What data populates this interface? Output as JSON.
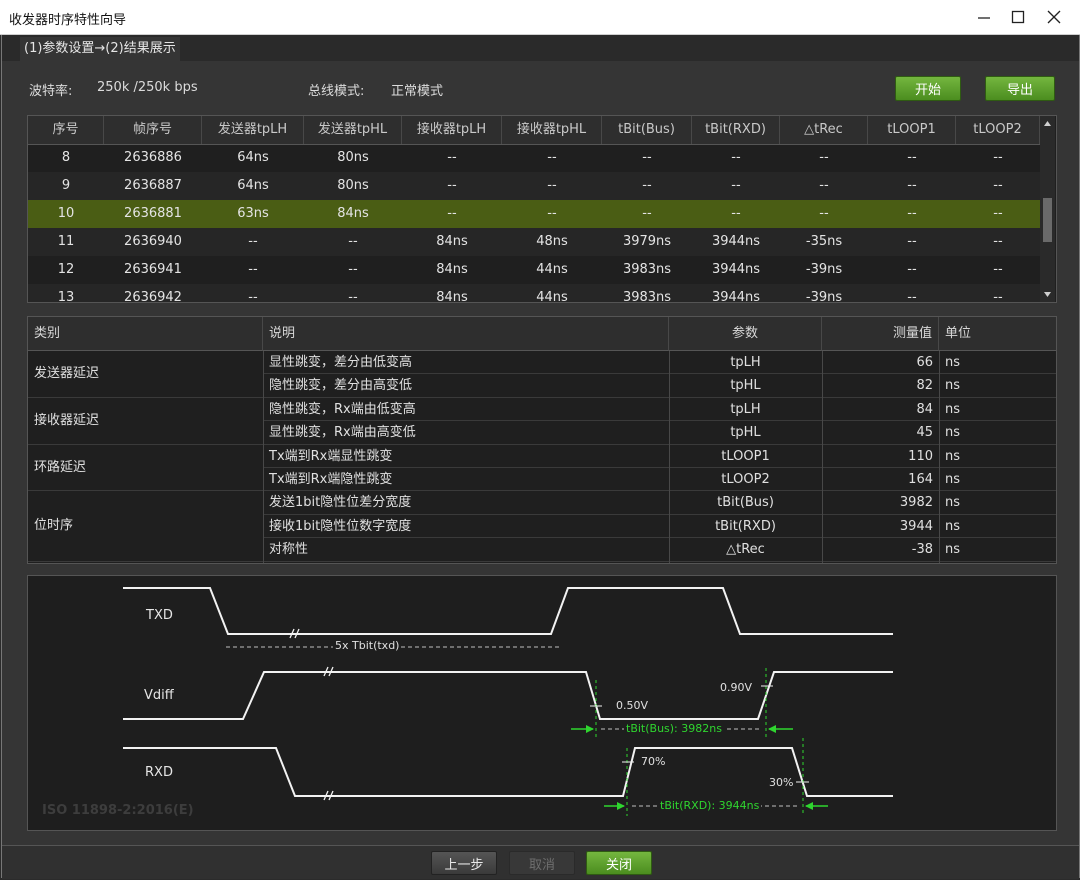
{
  "window": {
    "title": "收发器时序特性向导",
    "controls": [
      "minimize-icon",
      "maximize-icon",
      "close-icon"
    ]
  },
  "tabs": [
    {
      "label": "(1)参数设置→(2)结果展示"
    }
  ],
  "settings": {
    "baud_label": "波特率:",
    "baud_value": "250k /250k bps",
    "bus_mode_label": "总线模式:",
    "bus_mode_value": "正常模式"
  },
  "actions": {
    "start": "开始",
    "export": "导出"
  },
  "results_table": {
    "columns": [
      "序号",
      "帧序号",
      "发送器tpLH",
      "发送器tpHL",
      "接收器tpLH",
      "接收器tpHL",
      "tBit(Bus)",
      "tBit(RXD)",
      "△tRec",
      "tLOOP1",
      "tLOOP2"
    ],
    "rows": [
      [
        "8",
        "2636886",
        "64ns",
        "80ns",
        "--",
        "--",
        "--",
        "--",
        "--",
        "--",
        "--"
      ],
      [
        "9",
        "2636887",
        "64ns",
        "80ns",
        "--",
        "--",
        "--",
        "--",
        "--",
        "--",
        "--"
      ],
      [
        "10",
        "2636881",
        "63ns",
        "84ns",
        "--",
        "--",
        "--",
        "--",
        "--",
        "--",
        "--"
      ],
      [
        "11",
        "2636940",
        "--",
        "--",
        "84ns",
        "48ns",
        "3979ns",
        "3944ns",
        "-35ns",
        "--",
        "--"
      ],
      [
        "12",
        "2636941",
        "--",
        "--",
        "84ns",
        "44ns",
        "3983ns",
        "3944ns",
        "-39ns",
        "--",
        "--"
      ],
      [
        "13",
        "2636942",
        "--",
        "--",
        "84ns",
        "44ns",
        "3983ns",
        "3944ns",
        "-39ns",
        "--",
        "--"
      ]
    ],
    "selected_row_index": 2
  },
  "summary_table": {
    "headers": {
      "category": "类别",
      "desc": "说明",
      "param": "参数",
      "value": "测量值",
      "unit": "单位"
    },
    "groups": [
      {
        "category": "发送器延迟",
        "items": [
          {
            "desc": "显性跳变，差分由低变高",
            "param": "tpLH",
            "value": "66",
            "unit": "ns"
          },
          {
            "desc": "隐性跳变，差分由高变低",
            "param": "tpHL",
            "value": "82",
            "unit": "ns"
          }
        ]
      },
      {
        "category": "接收器延迟",
        "items": [
          {
            "desc": "隐性跳变，Rx端由低变高",
            "param": "tpLH",
            "value": "84",
            "unit": "ns"
          },
          {
            "desc": "显性跳变，Rx端由高变低",
            "param": "tpHL",
            "value": "45",
            "unit": "ns"
          }
        ]
      },
      {
        "category": "环路延迟",
        "items": [
          {
            "desc": "Tx端到Rx端显性跳变",
            "param": "tLOOP1",
            "value": "110",
            "unit": "ns"
          },
          {
            "desc": "Tx端到Rx端隐性跳变",
            "param": "tLOOP2",
            "value": "164",
            "unit": "ns"
          }
        ]
      },
      {
        "category": "位时序",
        "items": [
          {
            "desc": "发送1bit隐性位差分宽度",
            "param": "tBit(Bus)",
            "value": "3982",
            "unit": "ns"
          },
          {
            "desc": "接收1bit隐性位数字宽度",
            "param": "tBit(RXD)",
            "value": "3944",
            "unit": "ns"
          },
          {
            "desc": "对称性",
            "param": "△tRec",
            "value": "-38",
            "unit": "ns"
          }
        ]
      }
    ]
  },
  "waveform": {
    "signals": [
      "TXD",
      "Vdiff",
      "RXD"
    ],
    "txd_annotation": "5x Tbit(txd)",
    "thr_050": "0.50V",
    "thr_090": "0.90V",
    "tbit_bus": "tBit(Bus): 3982ns",
    "pct_70": "70%",
    "pct_30": "30%",
    "tbit_rxd": "tBit(RXD): 3944ns",
    "watermark": "ISO 11898-2:2016(E)",
    "colors": {
      "trace": "#f2f2f2",
      "marker": "#2fd52f",
      "dash": "#bdbdbd"
    }
  },
  "footer": {
    "prev": "上一步",
    "cancel": "取消",
    "close": "关闭"
  }
}
